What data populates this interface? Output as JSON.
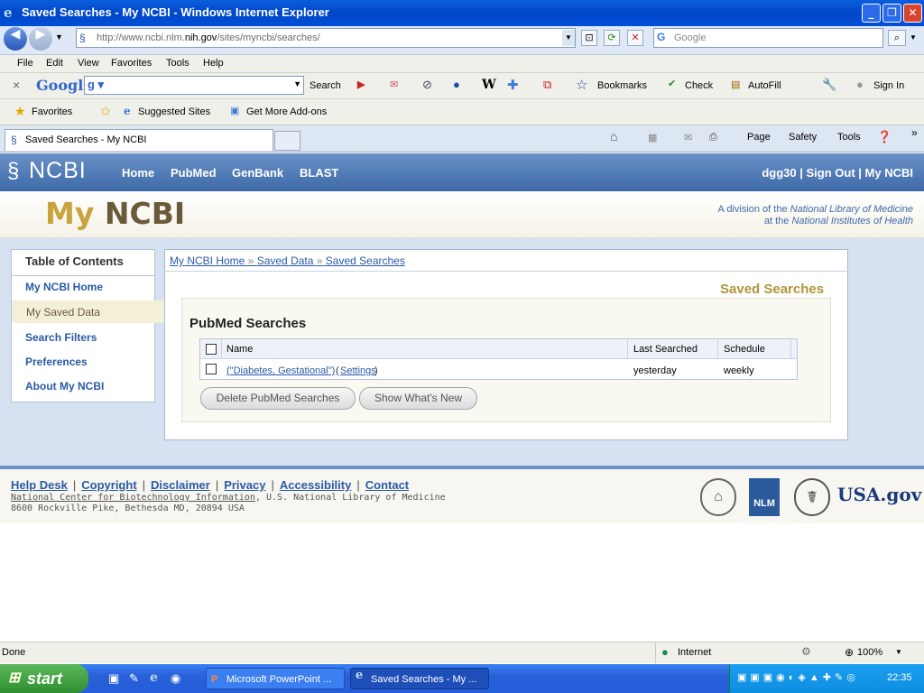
{
  "window": {
    "title": "Saved Searches - My NCBI - Windows Internet Explorer"
  },
  "addressbar": {
    "url_gray1": "http://www.ncbi.nlm.",
    "url_host": "nih.gov",
    "url_gray2": "/sites/myncbi/searches/",
    "search_placeholder": "Google"
  },
  "menu": [
    "File",
    "Edit",
    "View",
    "Favorites",
    "Tools",
    "Help"
  ],
  "googlebar": {
    "logo": "Google",
    "search": "Search",
    "bookmarks": "Bookmarks",
    "check": "Check",
    "autofill": "AutoFill",
    "signin": "Sign In"
  },
  "favbar": {
    "favorites": "Favorites",
    "suggested": "Suggested Sites",
    "addons": "Get More Add-ons"
  },
  "tab": {
    "label": "Saved Searches - My NCBI"
  },
  "commandbar": {
    "page": "Page",
    "safety": "Safety",
    "tools": "Tools"
  },
  "ncbi": {
    "logo": "NCBI",
    "nav": [
      "Home",
      "PubMed",
      "GenBank",
      "BLAST"
    ],
    "user": "dgg30",
    "signout": "Sign Out",
    "myncbi": "My NCBI",
    "banner_my": "My",
    "banner_ncbi": "NCBI",
    "division_line1_a": "A division of the ",
    "division_line1_b": "National Library of Medicine",
    "division_line2_a": "at the ",
    "division_line2_b": "National Institutes of Health"
  },
  "toc": {
    "heading": "Table of Contents",
    "items": [
      "My NCBI Home",
      "My Saved Data",
      "Search Filters",
      "Preferences",
      "About My NCBI"
    ]
  },
  "breadcrumb": [
    "My NCBI Home",
    "Saved Data",
    "Saved Searches"
  ],
  "page_title": "Saved Searches",
  "section_title": "PubMed Searches",
  "table": {
    "headers": [
      "Name",
      "Last Searched",
      "Schedule"
    ],
    "rows": [
      {
        "name": "(\"Diabetes, Gestational\")",
        "settings": "Settings",
        "last": "yesterday",
        "schedule": "weekly"
      }
    ]
  },
  "buttons": {
    "delete": "Delete PubMed Searches",
    "whatsnew": "Show What's New"
  },
  "footer": {
    "links": [
      "Help Desk",
      "Copyright",
      "Disclaimer",
      "Privacy",
      "Accessibility",
      "Contact"
    ],
    "addr_link": "National Center for Biotechnology Information",
    "addr_rest": ", U.S. National Library of Medicine",
    "addr2": "8600 Rockville Pike, Bethesda MD, 20894 USA",
    "logo_nlm": "NLM",
    "logo_usa": "USA.gov"
  },
  "status": {
    "left": "Done",
    "zone": "Internet",
    "zoom": "100%"
  },
  "taskbar": {
    "start": "start",
    "task1": "Microsoft PowerPoint ...",
    "task2": "Saved Searches - My ...",
    "clock": "22:35"
  }
}
